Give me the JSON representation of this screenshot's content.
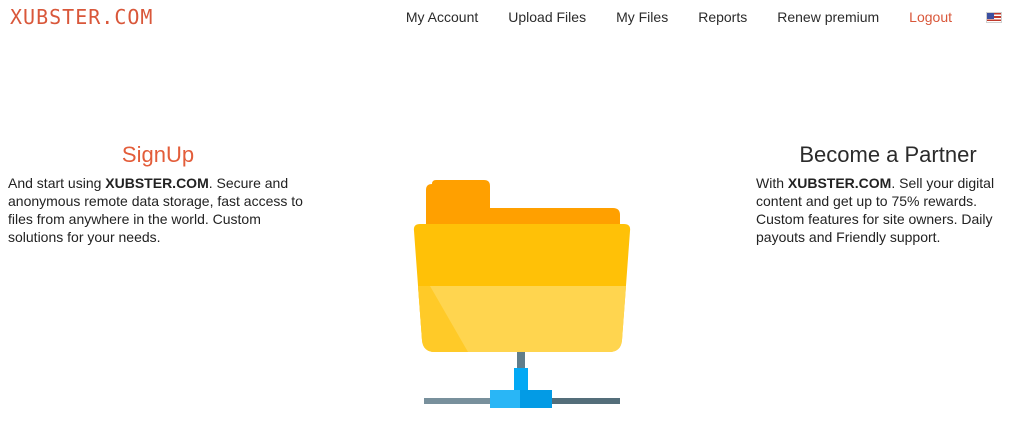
{
  "header": {
    "logo": "XUBSTER.COM",
    "nav": [
      {
        "label": "My Account"
      },
      {
        "label": "Upload Files"
      },
      {
        "label": "My Files"
      },
      {
        "label": "Reports"
      },
      {
        "label": "Renew premium"
      },
      {
        "label": "Logout"
      }
    ],
    "flag_icon": "us-flag-icon"
  },
  "signup": {
    "title": "SignUp",
    "text_prefix": "And start using ",
    "brand": "XUBSTER.COM",
    "text_suffix": ". Secure and anonymous remote data storage, fast access to files from anywhere in the world. Custom solutions for your needs."
  },
  "partner": {
    "title": "Become a Partner",
    "text_prefix": "With ",
    "brand": "XUBSTER.COM",
    "text_suffix": ". Sell your digital content and get up to 75% rewards. Custom features for site owners. Daily payouts and Friendly support."
  },
  "illustration": {
    "icon": "network-folder-icon",
    "colors": {
      "folder_back": "#ffa000",
      "folder_front": "#ffc107",
      "folder_front_light": "#ffd54f",
      "connector": "#03a9f4",
      "cable": "#607d8b"
    }
  }
}
